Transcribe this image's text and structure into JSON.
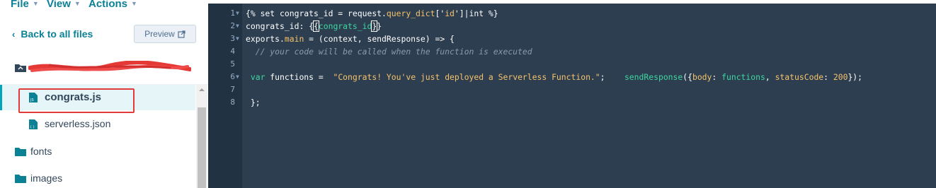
{
  "menubar": {
    "file": "File",
    "view": "View",
    "actions": "Actions"
  },
  "nav": {
    "back_label": "Back to all files",
    "preview_label": "Preview"
  },
  "tree": {
    "files": [
      {
        "name": "congrats.js",
        "active": true,
        "icon": "js-file-icon"
      },
      {
        "name": "serverless.json",
        "active": false,
        "icon": "json-file-icon"
      }
    ],
    "folders": [
      {
        "name": "fonts",
        "icon": "folder-icon"
      },
      {
        "name": "images",
        "icon": "folder-icon"
      }
    ]
  },
  "editor": {
    "line_numbers": [
      "1",
      "2",
      "3",
      "4",
      "5",
      "6",
      "7",
      "8"
    ],
    "lines": {
      "l1": {
        "a": "{% set ",
        "b": "congrats_id",
        "c": " = ",
        "d": "request",
        "e": ".",
        "f": "query_dict",
        "g": "['",
        "h": "id",
        "i": "']|",
        "j": "int",
        "k": " %}"
      },
      "l2": {
        "a": "congrats_id",
        "b": ": {",
        "c": "{",
        "d": "congrats_id",
        "e": "}",
        "f": "}"
      },
      "l3": {
        "a": "exports",
        "b": ".",
        "c": "main",
        "d": " = (context, sendResponse) => {"
      },
      "l4": {
        "a": "  // your code will be called when the function is executed"
      },
      "l6": {
        "a": " var ",
        "b": "functions",
        "c": " =  ",
        "d": "\"Congrats! You've just deployed a Serverless Function.\"",
        "e": ";    ",
        "f": "sendResponse",
        "g": "({",
        "h": "body",
        "i": ": ",
        "j": "functions",
        "k": ", ",
        "l": "statusCode",
        "m": ": ",
        "n": "200",
        "o": "});"
      },
      "l8": {
        "a": " };"
      }
    }
  },
  "colors": {
    "accent": "#0b8196",
    "highlight_box": "#e33b3b",
    "editor_bg": "#2d3e50",
    "gutter_bg": "#213343"
  }
}
